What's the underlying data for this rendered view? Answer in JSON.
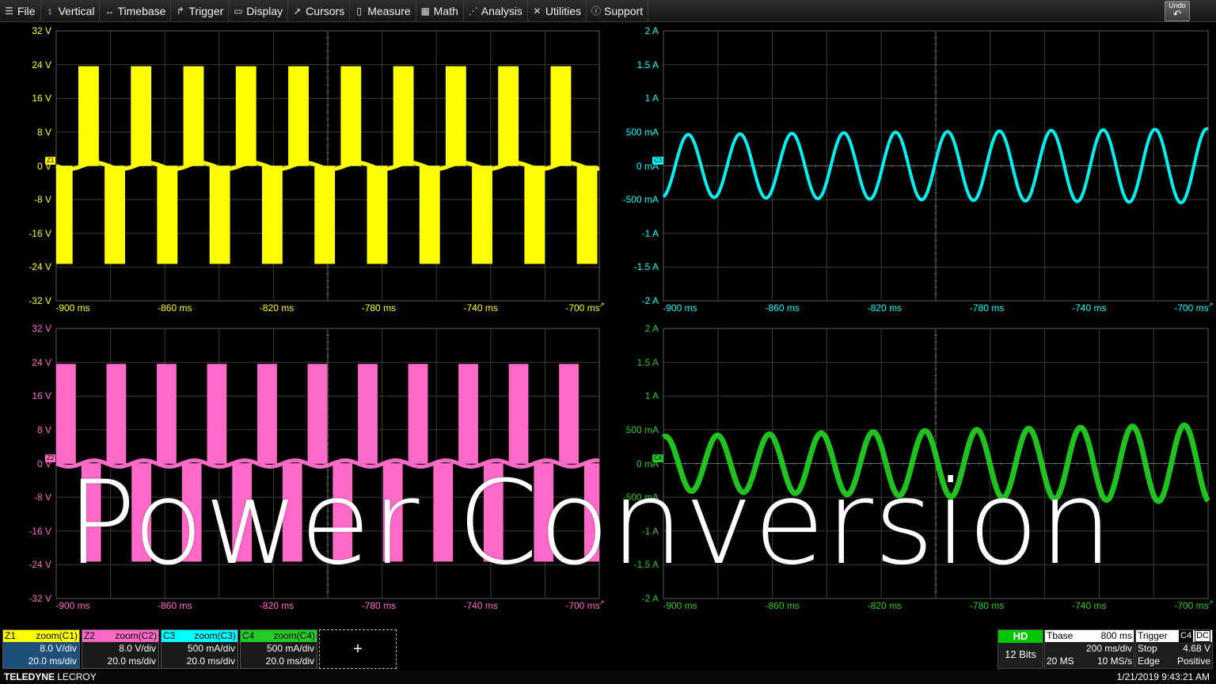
{
  "menu": {
    "items": [
      {
        "label": "File",
        "icon": "hamburger-icon",
        "glyph": "☰"
      },
      {
        "label": "Vertical",
        "icon": "vertical-arrows-icon",
        "glyph": "↕"
      },
      {
        "label": "Timebase",
        "icon": "horizontal-arrows-icon",
        "glyph": "↔"
      },
      {
        "label": "Trigger",
        "icon": "trigger-icon",
        "glyph": "↱"
      },
      {
        "label": "Display",
        "icon": "display-icon",
        "glyph": "▭"
      },
      {
        "label": "Cursors",
        "icon": "cursor-icon",
        "glyph": "➚"
      },
      {
        "label": "Measure",
        "icon": "measure-icon",
        "glyph": "▯"
      },
      {
        "label": "Math",
        "icon": "math-icon",
        "glyph": "▦"
      },
      {
        "label": "Analysis",
        "icon": "analysis-icon",
        "glyph": "⋰"
      },
      {
        "label": "Utilities",
        "icon": "tools-icon",
        "glyph": "✕"
      },
      {
        "label": "Support",
        "icon": "info-icon",
        "glyph": "ⓘ"
      }
    ],
    "undo_label": "Undo"
  },
  "grids": [
    {
      "id": "z1",
      "color": "#ffff00",
      "tag": "Z1",
      "y_labels": [
        "32 V",
        "24 V",
        "16 V",
        "8 V",
        "0 V",
        "-8 V",
        "-16 V",
        "-24 V",
        "-32 V"
      ],
      "x_labels": [
        "-900 ms",
        "-860 ms",
        "-820 ms",
        "-780 ms",
        "-740 ms",
        "-700 ms"
      ]
    },
    {
      "id": "c3",
      "color": "#00ffff",
      "tag": "C3",
      "y_labels": [
        "2 A",
        "1.5 A",
        "1 A",
        "500 mA",
        "0 mA",
        "-500 mA",
        "-1 A",
        "-1.5 A",
        "-2 A"
      ],
      "x_labels": [
        "-900 ms",
        "-860 ms",
        "-820 ms",
        "-780 ms",
        "-740 ms",
        "-700 ms"
      ]
    },
    {
      "id": "z2",
      "color": "#ff69c8",
      "tag": "Z2",
      "y_labels": [
        "32 V",
        "24 V",
        "16 V",
        "8 V",
        "0 V",
        "-8 V",
        "-16 V",
        "-24 V",
        "-32 V"
      ],
      "x_labels": [
        "-900 ms",
        "-860 ms",
        "-820 ms",
        "-780 ms",
        "-740 ms",
        "-700 ms"
      ]
    },
    {
      "id": "c4",
      "color": "#22cc22",
      "tag": "C4",
      "y_labels": [
        "2 A",
        "1.5 A",
        "1 A",
        "500 mA",
        "0 mA",
        "-500 mA",
        "-1 A",
        "-1.5 A",
        "-2 A"
      ],
      "x_labels": [
        "-900 ms",
        "-860 ms",
        "-820 ms",
        "-780 ms",
        "-740 ms",
        "-700 ms"
      ]
    }
  ],
  "channels": [
    {
      "name": "Z1",
      "source": "zoom(C1)",
      "color": "#ffff00",
      "vdiv": "8.0 V/div",
      "tdiv": "20.0 ms/div",
      "selected": true
    },
    {
      "name": "Z2",
      "source": "zoom(C2)",
      "color": "#ff69c8",
      "vdiv": "8.0 V/div",
      "tdiv": "20.0 ms/div",
      "selected": false
    },
    {
      "name": "C3",
      "source": "zoom(C3)",
      "color": "#00ffff",
      "vdiv": "500 mA/div",
      "tdiv": "20.0 ms/div",
      "selected": false
    },
    {
      "name": "C4",
      "source": "zoom(C4)",
      "color": "#22cc22",
      "vdiv": "500 mA/div",
      "tdiv": "20.0 ms/div",
      "selected": false
    }
  ],
  "add_label": "+",
  "acq": {
    "mode": "HD",
    "bits": "12 Bits"
  },
  "timebase": {
    "title": "Tbase",
    "offset": "800 ms",
    "tdiv": "200 ms/div",
    "samples": "20 MS",
    "rate": "10 MS/s"
  },
  "trigger": {
    "title": "Trigger",
    "source": "C4",
    "coupling": "DC",
    "mode": "Stop",
    "level": "4.68 V",
    "type": "Edge",
    "slope": "Positive"
  },
  "status": {
    "brand_bold": "TELEDYNE",
    "brand_light": "LECROY",
    "datetime": "1/21/2019 9:43:21 AM"
  },
  "overlay_title": "Power Conversion",
  "colors": {
    "grid": "#4a4a4a",
    "menu_bg": "#222222"
  }
}
